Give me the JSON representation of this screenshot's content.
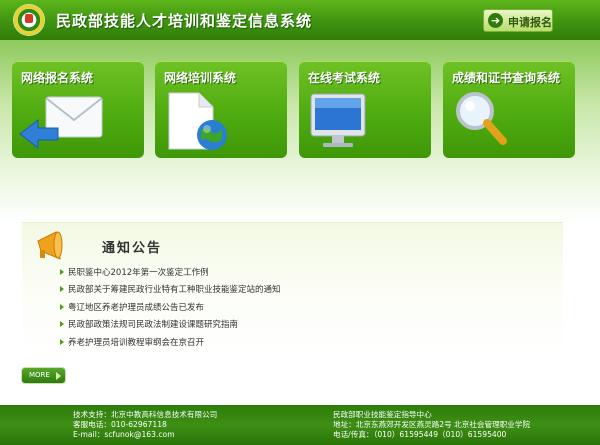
{
  "header": {
    "title": "民政部技能人才培训和鉴定信息系统",
    "apply_button": "申请报名",
    "logo_icon": "emblem-logo"
  },
  "modules": [
    {
      "title": "网络报名系统",
      "icon": "envelope-arrow-icon"
    },
    {
      "title": "网络培训系统",
      "icon": "document-globe-icon"
    },
    {
      "title": "在线考试系统",
      "icon": "monitor-icon"
    },
    {
      "title": "成绩和证书查询系统",
      "icon": "magnifier-icon"
    }
  ],
  "notice": {
    "heading": "通知公告",
    "icon": "megaphone-icon",
    "items": [
      "民职鉴中心2012年第一次鉴定工作例",
      "民政部关于筹建民政行业特有工种职业技能鉴定站的通知",
      "粤辽地区养老护理员成绩公告已发布",
      "民政部政策法规司民政法制建设课题研究指南",
      "养老护理员培训教程审纲会在京召开"
    ],
    "more_label": "MORE"
  },
  "footer": {
    "left": [
      "技术支持：北京中教高科信息技术有限公司",
      "客服电话：010-62967118",
      "E-mail：scfunok@163.com"
    ],
    "right": [
      "民政部职业技能鉴定指导中心",
      "地址：北京东燕郊开发区燕灵路2号 北京社会管理职业学院",
      "电话/传真：（010）61595449（010）61595400"
    ]
  },
  "colors": {
    "brand_green": "#3f9410",
    "card_green": "#4fab10",
    "footer_green": "#2d7d0a"
  }
}
